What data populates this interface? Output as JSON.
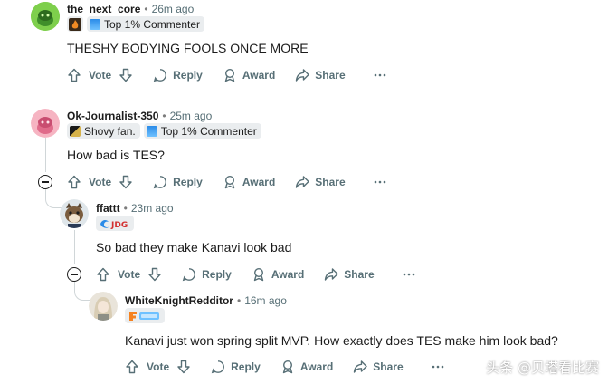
{
  "comments": [
    {
      "username": "the_next_core",
      "time": "26m ago",
      "flairs": [
        "Top 1% Commenter"
      ],
      "body": "THESHY BODYING FOOLS ONCE MORE",
      "actions": {
        "vote": "Vote",
        "reply": "Reply",
        "award": "Award",
        "share": "Share"
      }
    },
    {
      "username": "Ok-Journalist-350",
      "time": "25m ago",
      "flairs": [
        "Shovy fan.",
        "Top 1% Commenter"
      ],
      "body": "How bad is TES?",
      "actions": {
        "vote": "Vote",
        "reply": "Reply",
        "award": "Award",
        "share": "Share"
      }
    },
    {
      "username": "ffattt",
      "time": "23m ago",
      "flairs": [],
      "body": "So bad they make Kanavi look bad",
      "actions": {
        "vote": "Vote",
        "reply": "Reply",
        "award": "Award",
        "share": "Share"
      }
    },
    {
      "username": "WhiteKnightRedditor",
      "time": "16m ago",
      "flairs": [],
      "body": "Kanavi just won spring split MVP. How exactly does TES make him look bad?",
      "actions": {
        "vote": "Vote",
        "reply": "Reply",
        "award": "Award",
        "share": "Share"
      }
    }
  ],
  "watermark": "头条 @贝塔看比赛",
  "colors": {
    "meta": "#576f76",
    "flair_bg": "#eaedef",
    "thread_line": "#d0d6d8"
  },
  "icons": [
    "upvote-icon",
    "downvote-icon",
    "reply-icon",
    "award-icon",
    "share-icon",
    "more-icon",
    "collapse-icon"
  ]
}
